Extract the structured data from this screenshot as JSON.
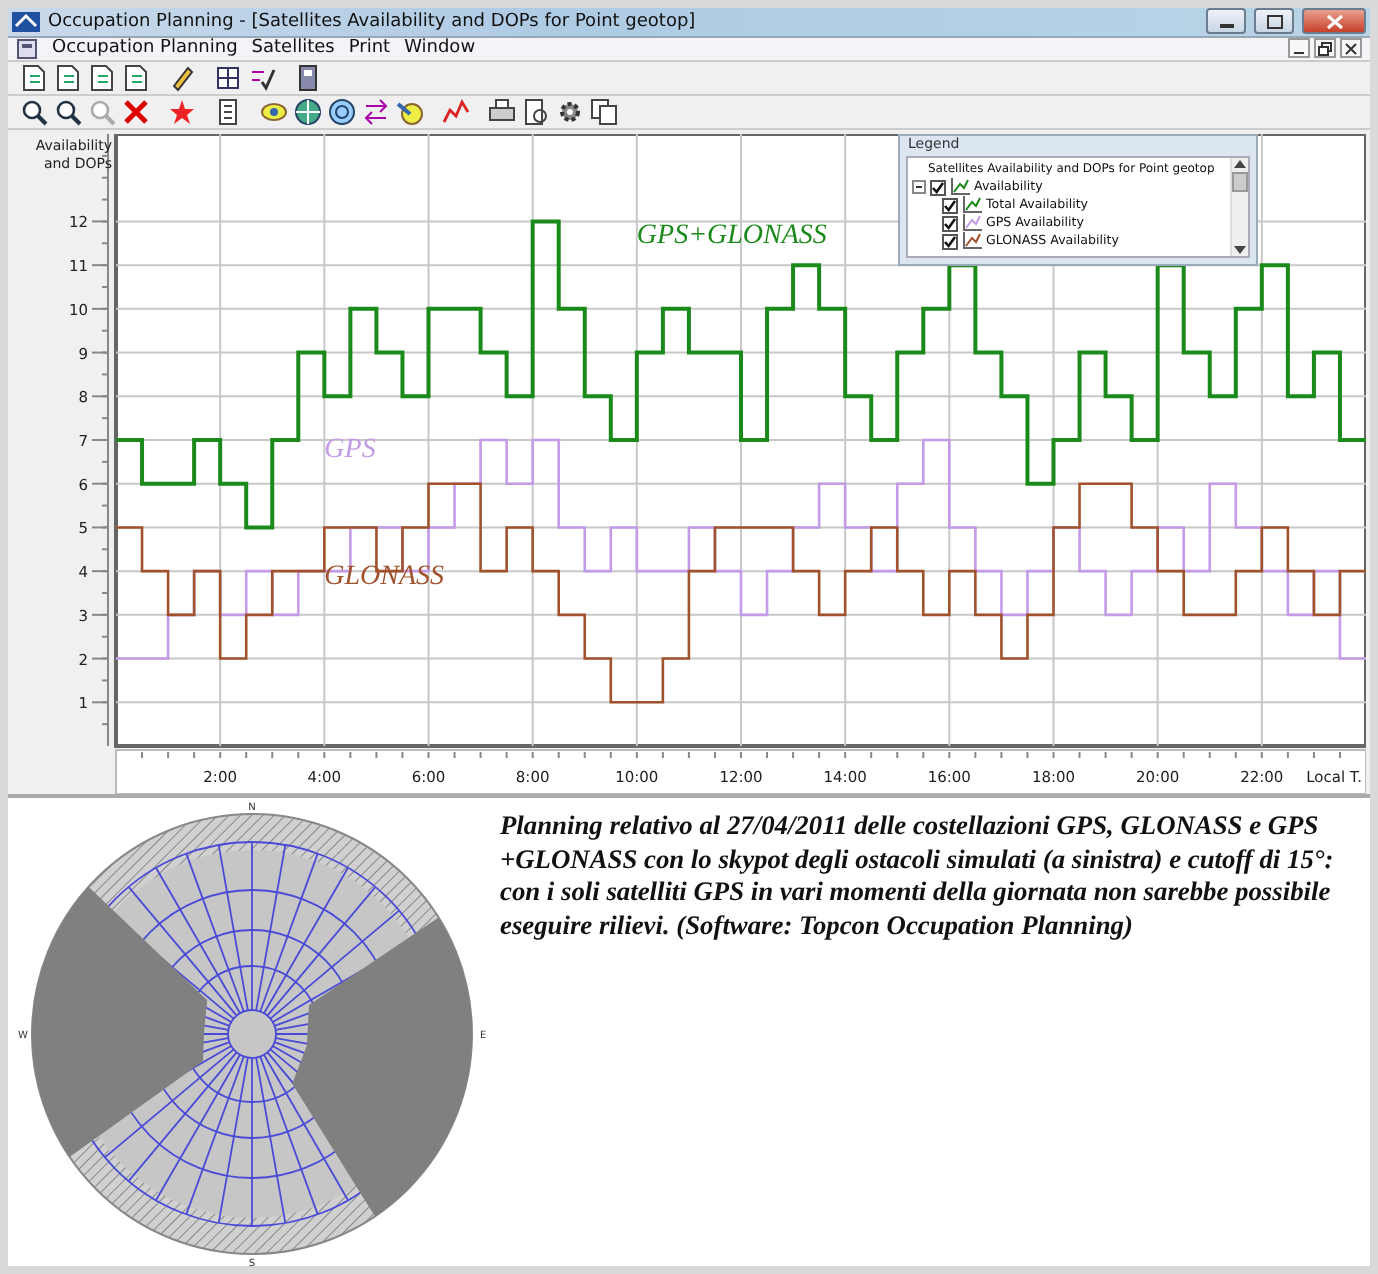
{
  "window": {
    "title": "Occupation Planning - [Satellites Availability and DOPs for Point geotop]"
  },
  "menu": [
    "Occupation Planning",
    "Satellites",
    "Print",
    "Window"
  ],
  "chart": {
    "chart_data": {
      "type": "line",
      "title": "Satellites Availability and DOPs for Point geotop",
      "xlabel": "Local T.",
      "ylabel": "Availability and DOPs",
      "xlim": [
        0,
        24
      ],
      "ylim": [
        0,
        14
      ],
      "grid": true,
      "x": [
        0,
        0.5,
        0.5,
        1,
        1,
        1.5,
        1.5,
        2,
        2,
        2.5,
        2.5,
        3,
        3,
        3.5,
        3.5,
        4,
        4,
        4.5,
        4.5,
        5,
        5,
        5.5,
        5.5,
        6,
        6,
        6.5,
        6.5,
        7,
        7,
        7.5,
        7.5,
        8,
        8,
        8.5,
        8.5,
        9,
        9,
        9.5,
        9.5,
        10,
        10,
        10.5,
        10.5,
        11,
        11,
        11.5,
        11.5,
        12,
        12,
        12.5,
        12.5,
        13,
        13,
        13.5,
        13.5,
        14,
        14,
        14.5,
        14.5,
        15,
        15,
        15.5,
        15.5,
        16,
        16,
        16.5,
        16.5,
        17,
        17,
        17.5,
        17.5,
        18,
        18,
        18.5,
        18.5,
        19,
        19,
        19.5,
        19.5,
        20,
        20,
        20.5,
        20.5,
        21,
        21,
        21.5,
        21.5,
        22,
        22,
        22.5,
        22.5,
        23,
        23,
        23.5,
        23.5,
        24
      ],
      "series": [
        {
          "name": "GPS+GLONASS",
          "color": "#1a8a1a",
          "values": [
            7,
            7,
            6,
            6,
            6,
            6,
            7,
            7,
            6,
            6,
            5,
            5,
            7,
            7,
            9,
            9,
            8,
            8,
            10,
            10,
            9,
            9,
            8,
            8,
            10,
            10,
            10,
            10,
            9,
            9,
            8,
            8,
            12,
            12,
            10,
            10,
            8,
            8,
            7,
            7,
            9,
            9,
            10,
            10,
            9,
            9,
            9,
            9,
            7,
            7,
            10,
            10,
            11,
            11,
            10,
            10,
            8,
            8,
            7,
            7,
            9,
            9,
            10,
            10,
            11,
            11,
            9,
            9,
            8,
            8,
            6,
            6,
            7,
            7,
            9,
            9,
            8,
            8,
            7,
            7,
            11,
            11,
            9,
            9,
            8,
            8,
            10,
            10,
            11,
            11,
            8,
            8,
            9,
            9,
            7,
            7
          ]
        },
        {
          "name": "GPS",
          "color": "#c39be8",
          "values": [
            2,
            2,
            2,
            2,
            3,
            3,
            4,
            4,
            3,
            3,
            4,
            4,
            3,
            3,
            4,
            4,
            4,
            4,
            5,
            5,
            5,
            5,
            4,
            4,
            5,
            5,
            6,
            6,
            7,
            7,
            6,
            6,
            7,
            7,
            5,
            5,
            4,
            4,
            5,
            5,
            4,
            4,
            4,
            4,
            5,
            5,
            4,
            4,
            3,
            3,
            4,
            4,
            5,
            5,
            6,
            6,
            5,
            5,
            4,
            4,
            6,
            6,
            7,
            7,
            5,
            5,
            4,
            4,
            3,
            3,
            4,
            4,
            5,
            5,
            4,
            4,
            3,
            3,
            4,
            4,
            5,
            5,
            4,
            4,
            6,
            6,
            5,
            5,
            4,
            4,
            3,
            3,
            4,
            4,
            2,
            2
          ]
        },
        {
          "name": "GLONASS",
          "color": "#a0522d",
          "values": [
            5,
            5,
            4,
            4,
            3,
            3,
            4,
            4,
            2,
            2,
            3,
            3,
            4,
            4,
            4,
            4,
            5,
            5,
            5,
            5,
            4,
            4,
            5,
            5,
            6,
            6,
            6,
            6,
            4,
            4,
            5,
            5,
            4,
            4,
            3,
            3,
            2,
            2,
            1,
            1,
            1,
            1,
            2,
            2,
            4,
            4,
            5,
            5,
            5,
            5,
            5,
            5,
            4,
            4,
            3,
            3,
            4,
            4,
            5,
            5,
            4,
            4,
            3,
            3,
            4,
            4,
            3,
            3,
            2,
            2,
            3,
            3,
            5,
            5,
            6,
            6,
            6,
            6,
            5,
            5,
            4,
            4,
            3,
            3,
            3,
            3,
            4,
            4,
            5,
            5,
            4,
            4,
            3,
            3,
            4,
            4
          ]
        }
      ],
      "xticks": [
        {
          "value": 2,
          "label": "2:00"
        },
        {
          "value": 4,
          "label": "4:00"
        },
        {
          "value": 6,
          "label": "6:00"
        },
        {
          "value": 8,
          "label": "8:00"
        },
        {
          "value": 10,
          "label": "10:00"
        },
        {
          "value": 12,
          "label": "12:00"
        },
        {
          "value": 14,
          "label": "14:00"
        },
        {
          "value": 16,
          "label": "16:00"
        },
        {
          "value": 18,
          "label": "18:00"
        },
        {
          "value": 20,
          "label": "20:00"
        },
        {
          "value": 22,
          "label": "22:00"
        }
      ],
      "yticks": [
        1,
        2,
        3,
        4,
        5,
        6,
        7,
        8,
        9,
        10,
        11,
        12
      ]
    }
  },
  "legend": {
    "heading": "Legend",
    "tree": {
      "children": [
        {
          "label": "Availability",
          "checked": true,
          "expanded": true,
          "children": [
            {
              "label": "Total Availability",
              "checked": true
            },
            {
              "label": "GPS Availability",
              "checked": true
            },
            {
              "label": "GLONASS Availability",
              "checked": true
            }
          ]
        }
      ]
    }
  },
  "skyplot": {
    "north": "N",
    "east": "E",
    "south": "S",
    "west": "W"
  },
  "caption": "Planning relativo al 27/04/2011 delle costellazioni GPS, GLONASS e GPS +GLONASS con lo skypot degli ostacoli simulati (a sinistra) e cutoff di 15°: con i soli satelliti GPS in vari momenti della giornata non sarebbe possibile eseguire rilievi. (Software: Topcon Occupation Planning)"
}
